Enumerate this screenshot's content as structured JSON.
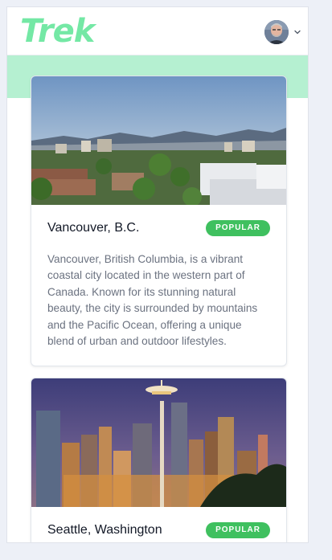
{
  "header": {
    "logo": "Trek",
    "user_avatar_icon": "user-avatar",
    "menu_icon": "chevron-down-icon"
  },
  "colors": {
    "brand": "#74e8a5",
    "band": "#b5f0d1",
    "badge": "#3fc05f"
  },
  "destinations": [
    {
      "title": "Vancouver, B.C.",
      "badge": "POPULAR",
      "description": "Vancouver, British Columbia, is a vibrant coastal city located in the western part of Canada. Known for its stunning natural beauty, the city is surrounded by mountains and the Pacific Ocean, offering a unique blend of urban and outdoor lifestyles."
    },
    {
      "title": "Seattle, Washington",
      "badge": "POPULAR"
    }
  ]
}
